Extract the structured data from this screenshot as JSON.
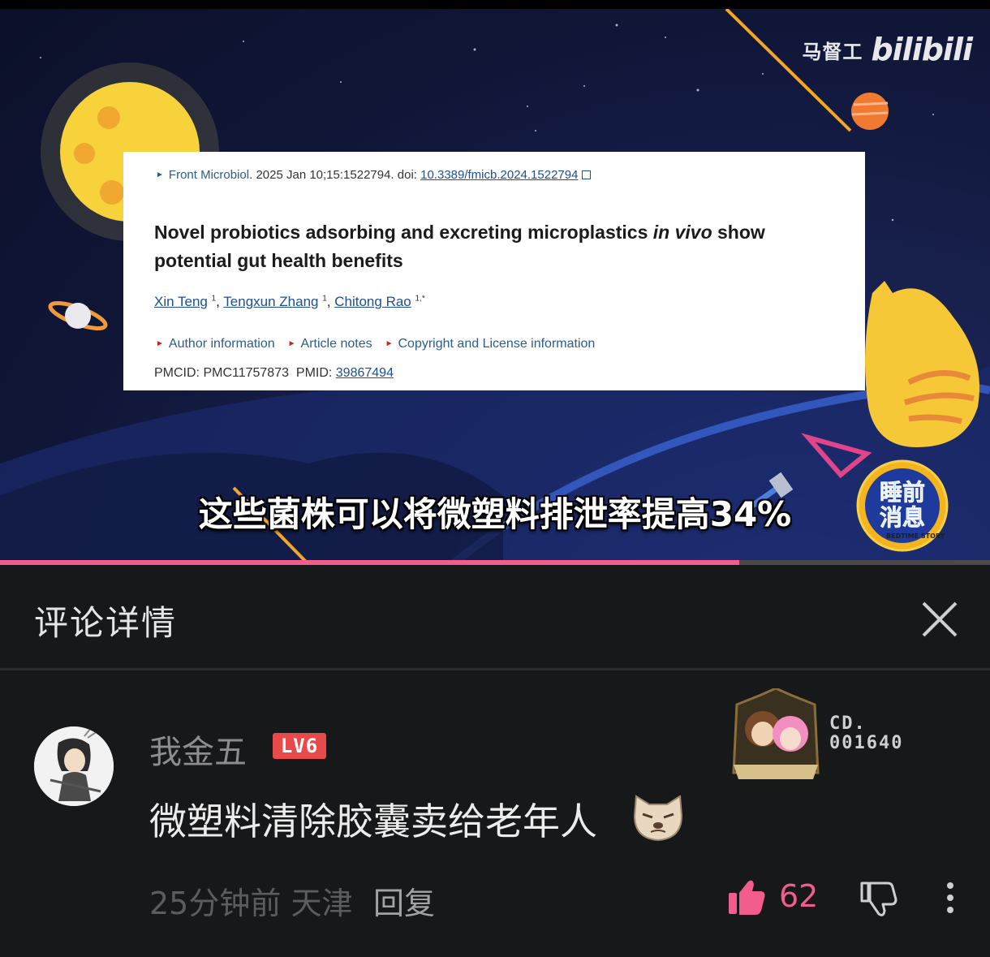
{
  "video": {
    "watermark_name": "马督工",
    "watermark_logo": "bilibili",
    "paper": {
      "journal": "Front Microbiol",
      "citation": ". 2025 Jan 10;15:1522794. doi: ",
      "doi": "10.3389/fmicb.2024.1522794",
      "title_part1": "Novel probiotics adsorbing and excreting microplastics ",
      "title_italic": "in vivo",
      "title_part2": " show potential gut health benefits",
      "authors": [
        {
          "name": "Xin Teng",
          "sup": "1"
        },
        {
          "name": "Tengxun Zhang",
          "sup": "1"
        },
        {
          "name": "Chitong Rao",
          "sup": "1,*"
        }
      ],
      "links": [
        "Author information",
        "Article notes",
        "Copyright and License information"
      ],
      "pmcid": "PMCID: PMC11757873",
      "pmid_label": "PMID: ",
      "pmid": "39867494"
    },
    "subtitle": "这些菌株可以将微塑料排泄率提高34%",
    "badge_text": "睡前消息",
    "badge_sub": "BEDTIME STORY",
    "progress": 0.747
  },
  "panel": {
    "title": "评论详情"
  },
  "comment": {
    "username": "我金五",
    "level": "LV6",
    "fan_badge_code_line1": "CD.",
    "fan_badge_code_line2": "001640",
    "text": "微塑料清除胶囊卖给老年人",
    "time": "25分钟前",
    "location": "天津",
    "reply_label": "回复",
    "likes": "62"
  },
  "colors": {
    "accent": "#f25d8e",
    "level_badge": "#e84a4a",
    "background": "#17181a"
  }
}
